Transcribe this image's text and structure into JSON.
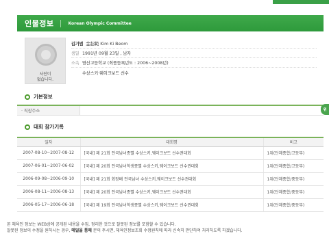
{
  "header": {
    "title": "인물정보",
    "subtitle": "Korean Olympic Committee"
  },
  "photo": {
    "placeholder_label_line1": "사진이",
    "placeholder_label_line2": "없습니다."
  },
  "profile": {
    "name_ko": "김기범",
    "name_hanja_en": "金起範 Kim Ki Beom",
    "birth_label": "생일",
    "birth_value": "1991년 09월 23일 , 남자",
    "affiliation_label": "소속",
    "affiliation_value": "영신고등학교 (최종등록년도 : 2006~2008년)",
    "sport_value": "수상스키·웨이크보드 선수"
  },
  "basic_info": {
    "title": "기본정보",
    "address_header": "· 직장주소",
    "address_value": ""
  },
  "records": {
    "title": "대회 참가기록",
    "columns": [
      "일자",
      "대회명",
      "비고"
    ],
    "rows": [
      {
        "date": "2007-08-10~2007-08-12",
        "event": "[국내] 제 21회 전국남녀종별 수상스키,웨이크보드 선수권대회",
        "note": "1위(단체종합/고등부)"
      },
      {
        "date": "2007-06-01~2007-06-02",
        "event": "[국내] 제 20회 전국남녀학생종별 수상스키,웨이크보드 선수권대회",
        "note": "1위(단체종합/고등부)"
      },
      {
        "date": "2006-09-08~2006-09-10",
        "event": "[국내] 제 21회 회장배 전국남녀 수상스키,웨이크보드 선수권대회",
        "note": "1위(단체종합/중등부)"
      },
      {
        "date": "2006-08-11~2006-08-13",
        "event": "[국내] 제 20회 전국남녀종별 수상스키,웨이크보드 선수권대회",
        "note": "1위(단체종합/중등부)"
      },
      {
        "date": "2006-05-17~2006-06-18",
        "event": "[국내] 제 19회 전국남녀학생종별 수상스키,웨이크보드 선수권대회",
        "note": "1위(단체종합/중등부)"
      }
    ]
  },
  "side_badge": "위",
  "footer": {
    "line1": "본 체육인 정보는 WEB상에 공개된 내용을 수집, 정리한 것으로 잘못된 정보를 포함할 수 있습니다.",
    "line2_pre": "잘못된 정보의 수정을 원하시는 경우, ",
    "line2_bold": "메일을 통해",
    "line2_post": " 문의 주시면, 체육인정보조회 수정원칙에 따라 신속히 판단하여 처리하도록 하겠습니다."
  },
  "colors": {
    "brand_green": "#3aa047",
    "section_bullet": "#4b9a2b",
    "table_top_border": "#7ab35a"
  }
}
